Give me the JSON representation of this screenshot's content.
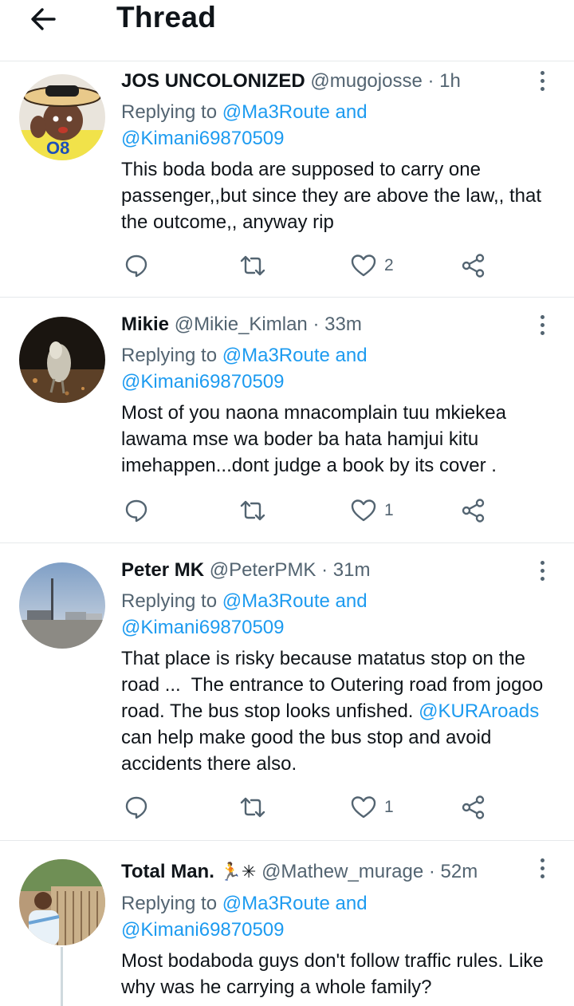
{
  "header": {
    "title": "Thread",
    "back_icon": "arrow-left-icon"
  },
  "tweets": [
    {
      "name": "JOS UNCOLONIZED",
      "handle": "@mugojosse",
      "separator": "·",
      "time": "1h",
      "replying_prefix": "Replying to ",
      "reply_mention_1": "@Ma3Route",
      "reply_joiner": " and",
      "reply_mention_2": "@Kimani69870509",
      "text": "This boda boda are supposed to carry one passenger,,but since they are above the law,, that the outcome,, anyway rip",
      "likes": "2"
    },
    {
      "name": "Mikie",
      "handle": "@Mikie_Kimlan",
      "separator": "·",
      "time": "33m",
      "replying_prefix": "Replying to ",
      "reply_mention_1": "@Ma3Route",
      "reply_joiner": " and",
      "reply_mention_2": "@Kimani69870509",
      "text": "Most of you naona mnacomplain tuu mkiekea lawama mse wa boder ba hata hamjui kitu imehappen...dont judge a book by its cover .",
      "likes": "1"
    },
    {
      "name": "Peter MK",
      "handle": "@PeterPMK",
      "separator": "·",
      "time": "31m",
      "replying_prefix": "Replying to ",
      "reply_mention_1": "@Ma3Route",
      "reply_joiner": " and",
      "reply_mention_2": "@Kimani69870509",
      "text_part1": "That place is risky because matatus stop on the road ...  The entrance to Outering road from jogoo road. The bus stop looks unfished. ",
      "text_mention": "@KURAroads",
      "text_part2": "  can help make good the bus stop and avoid accidents there also.",
      "likes": "1"
    },
    {
      "name": "Total Man.",
      "name_emoji": "🏃✳",
      "handle": "@Mathew_murage",
      "separator": "·",
      "time": "52m",
      "replying_prefix": "Replying to ",
      "reply_mention_1": "@Ma3Route",
      "reply_joiner": " and",
      "reply_mention_2": "@Kimani69870509",
      "text": "Most bodaboda guys don't follow traffic rules. Like why was he carrying a whole family?"
    }
  ],
  "icons": {
    "reply": "comment-icon",
    "retweet": "retweet-icon",
    "like": "heart-icon",
    "share": "share-icon",
    "more": "more-vertical-icon"
  },
  "colors": {
    "accent": "#1d9bf0",
    "secondary_text": "#536471",
    "divider": "#e6e9eb"
  }
}
